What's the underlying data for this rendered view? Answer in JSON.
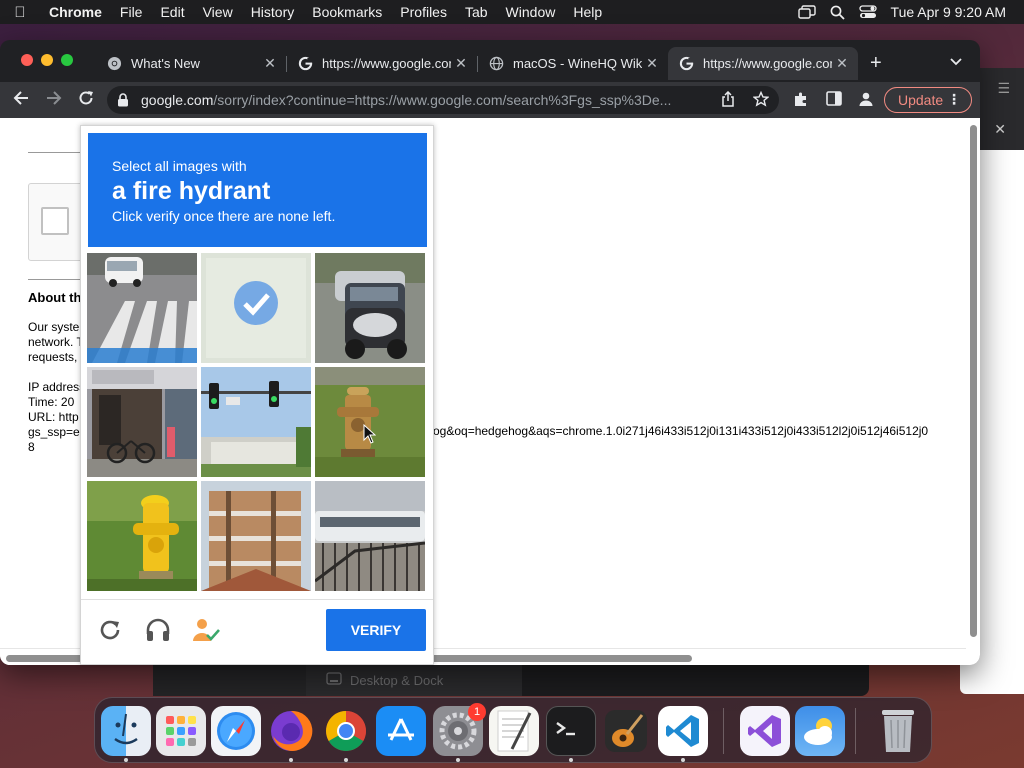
{
  "menubar": {
    "app_name": "Chrome",
    "items": [
      "File",
      "Edit",
      "View",
      "History",
      "Bookmarks",
      "Profiles",
      "Tab",
      "Window",
      "Help"
    ],
    "datetime": "Tue Apr 9  9:20 AM"
  },
  "browser": {
    "tabs": [
      {
        "title": "What's New",
        "active": false
      },
      {
        "title": "https://www.google.com/sorry/index",
        "active": false
      },
      {
        "title": "macOS - WineHQ Wiki",
        "active": false
      },
      {
        "title": "https://www.google.com/sorry/index",
        "active": true
      }
    ],
    "address": {
      "host": "google.com",
      "path": "/sorry/index?continue=https://www.google.com/search%3Fgs_ssp%3De..."
    },
    "update_label": "Update"
  },
  "page": {
    "about_heading": "About this page",
    "paragraph_lines": [
      "Our systems have detected unusual traffic from your computer",
      "network. This page checks to see if it's really you sending the",
      "requests, and not a robot."
    ],
    "ip_label": "IP address:",
    "time_label": "Time: 20",
    "url_label": "URL: http",
    "gs_line": "gs_ssp=e",
    "last_line": "8",
    "url_tail": "og&oq=hedgehog&aqs=chrome.1.0i271j46i433i512j0i131i433i512j0i433i512l2j0i512j46i512j0"
  },
  "captcha": {
    "prompt_line1": "Select all images with",
    "prompt_target": "a fire hydrant",
    "prompt_line3": "Click verify once there are none left.",
    "verify_label": "VERIFY",
    "tiles": [
      {
        "subject": "crosswalk with car",
        "selected": false
      },
      {
        "subject": "selected tile",
        "selected": true
      },
      {
        "subject": "motorcycle and cars",
        "selected": false
      },
      {
        "subject": "storefront with bicycle",
        "selected": false
      },
      {
        "subject": "traffic lights",
        "selected": false
      },
      {
        "subject": "fire hydrant on grass",
        "selected": false
      },
      {
        "subject": "yellow fire hydrant",
        "selected": false
      },
      {
        "subject": "building construction",
        "selected": false
      },
      {
        "subject": "buses behind fence",
        "selected": false
      }
    ]
  },
  "background": {
    "settings_item": "Desktop & Dock"
  },
  "dock": {
    "apps": [
      "Finder",
      "Launchpad",
      "Safari",
      "Firefox",
      "Chrome",
      "App Store",
      "System Settings",
      "TextEdit",
      "Terminal",
      "GarageBand",
      "Visual Studio Code",
      "Visual Studio",
      "Weather",
      "Trash"
    ],
    "system_settings_badge": "1"
  },
  "colors": {
    "captcha_blue": "#1a73e8",
    "update_accent": "#f28b82",
    "chrome_dark": "#202124"
  }
}
